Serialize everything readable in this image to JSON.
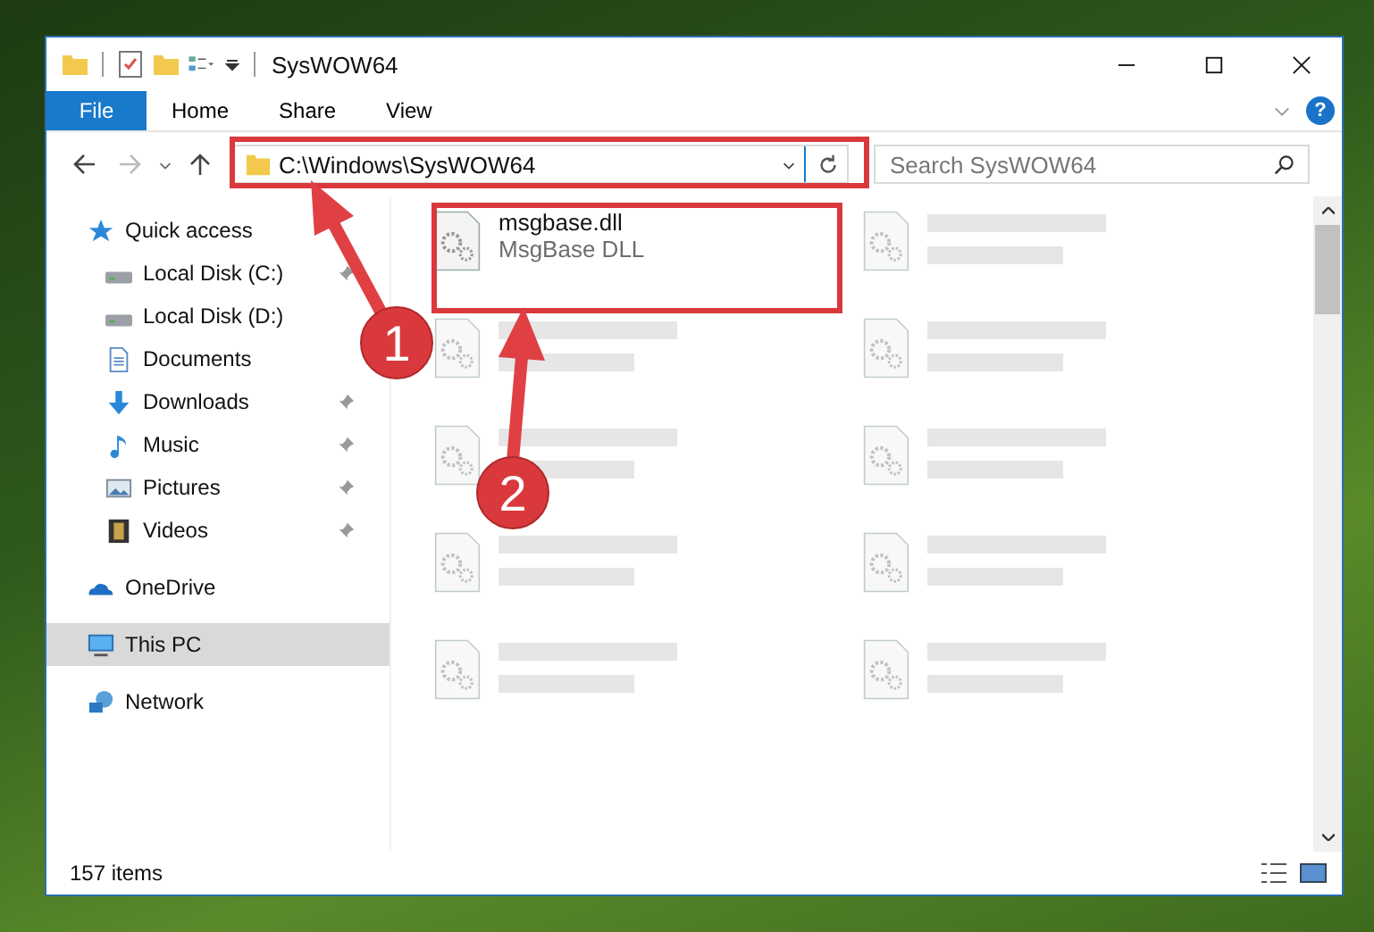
{
  "window": {
    "title": "SysWOW64"
  },
  "ribbon_tabs": [
    {
      "label": "File",
      "kind": "file",
      "selected": false
    },
    {
      "label": "Home",
      "kind": "tab",
      "selected": false
    },
    {
      "label": "Share",
      "kind": "tab",
      "selected": false
    },
    {
      "label": "View",
      "kind": "tab",
      "selected": false
    }
  ],
  "help_button": {
    "label": "?"
  },
  "address": {
    "path": "C:\\Windows\\SysWOW64"
  },
  "search": {
    "placeholder": "Search SysWOW64"
  },
  "sidebar": {
    "items": [
      {
        "label": "Quick access",
        "kind": "quick",
        "pinned": false,
        "selected": false,
        "children": [
          {
            "label": "Local Disk (C:)",
            "kind": "disk",
            "pinned": true,
            "selected": false
          },
          {
            "label": "Local Disk (D:)",
            "kind": "disk",
            "pinned": false,
            "selected": false
          },
          {
            "label": "Documents",
            "kind": "docs",
            "pinned": false,
            "selected": false
          },
          {
            "label": "Downloads",
            "kind": "down",
            "pinned": true,
            "selected": false
          },
          {
            "label": "Music",
            "kind": "music",
            "pinned": true,
            "selected": false
          },
          {
            "label": "Pictures",
            "kind": "pics",
            "pinned": true,
            "selected": false
          },
          {
            "label": "Videos",
            "kind": "video",
            "pinned": true,
            "selected": false
          }
        ]
      },
      {
        "label": "OneDrive",
        "kind": "cloud",
        "pinned": false,
        "selected": false
      },
      {
        "label": "This PC",
        "kind": "pc",
        "pinned": false,
        "selected": true
      },
      {
        "label": "Network",
        "kind": "network",
        "pinned": false,
        "selected": false
      }
    ]
  },
  "files": [
    {
      "name": "msgbase.dll",
      "type": "MsgBase DLL",
      "blurred": false
    },
    {
      "blurred": true
    },
    {
      "blurred": true
    },
    {
      "blurred": true
    },
    {
      "blurred": true
    },
    {
      "blurred": true
    },
    {
      "blurred": true
    },
    {
      "blurred": true
    },
    {
      "blurred": true
    },
    {
      "blurred": true
    }
  ],
  "status_bar": {
    "count": "157 items"
  },
  "annotations": [
    {
      "number": "1"
    },
    {
      "number": "2"
    }
  ]
}
